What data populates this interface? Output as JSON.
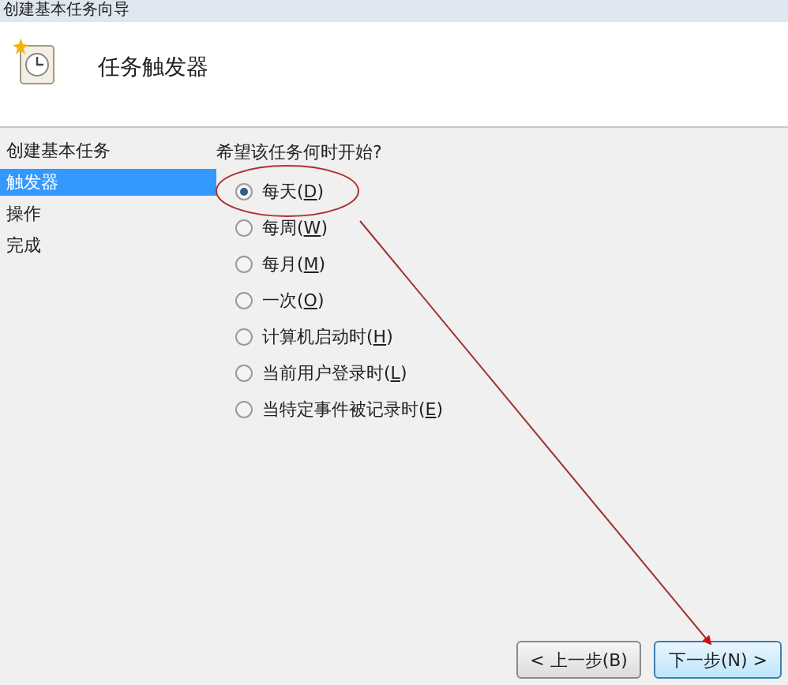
{
  "window": {
    "title": "创建基本任务向导"
  },
  "header": {
    "title": "任务触发器"
  },
  "steps": [
    {
      "label": "创建基本任务",
      "selected": false
    },
    {
      "label": "触发器",
      "selected": true
    },
    {
      "label": "操作",
      "selected": false
    },
    {
      "label": "完成",
      "selected": false
    }
  ],
  "question": "希望该任务何时开始?",
  "options": [
    {
      "label": "每天(D)",
      "selected": true
    },
    {
      "label": "每周(W)",
      "selected": false
    },
    {
      "label": "每月(M)",
      "selected": false
    },
    {
      "label": "一次(O)",
      "selected": false
    },
    {
      "label": "计算机启动时(H)",
      "selected": false
    },
    {
      "label": "当前用户登录时(L)",
      "selected": false
    },
    {
      "label": "当特定事件被记录时(E)",
      "selected": false
    }
  ],
  "buttons": [
    {
      "label": "< 上一步(B)",
      "kind": "back"
    },
    {
      "label": "下一步(N) >",
      "kind": "next"
    }
  ]
}
